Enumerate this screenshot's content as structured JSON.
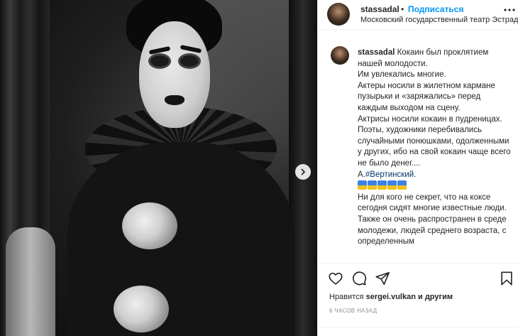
{
  "post": {
    "username": "stassadal",
    "separator": "•",
    "follow_label": "Подписаться",
    "location": "Московский государственный театр Эстрады",
    "caption": {
      "username": "stassadal",
      "first_line": "Кокаин был проклятием нашей молодости.",
      "lines": [
        "Им увлекались многие.",
        "Актеры носили в жилетном кармане пузырьки и «заряжались» перед каждым выходом на сцену.",
        "Актрисы носили кокаин в пудреницах.",
        "Поэты, художники перебивались случайными понюшками, одолженными у других, ибо на свой кокаин чаще всего не было денег...."
      ],
      "author_prefix": "А.",
      "hashtag": "#Вертинский",
      "author_suffix": ".",
      "lines_after": [
        "Ни для кого не секрет, что на коксе сегодня сидят многие известные люди.",
        "Также он очень распространен в среде молодежи, людей среднего возраста, с определенным"
      ]
    },
    "likes": {
      "prefix": "Нравится",
      "user": "sergei.vulkan",
      "suffix": "и другим"
    },
    "timestamp": "6 часов назад"
  },
  "icons": {
    "next": "chevron-right-icon",
    "more": "more-options-icon",
    "like": "heart-icon",
    "comment": "comment-icon",
    "share": "share-icon",
    "save": "bookmark-icon"
  },
  "colors": {
    "accent": "#0095f6",
    "link": "#00376b",
    "text": "#262626",
    "muted": "#8e8e8e",
    "border": "#efefef"
  }
}
